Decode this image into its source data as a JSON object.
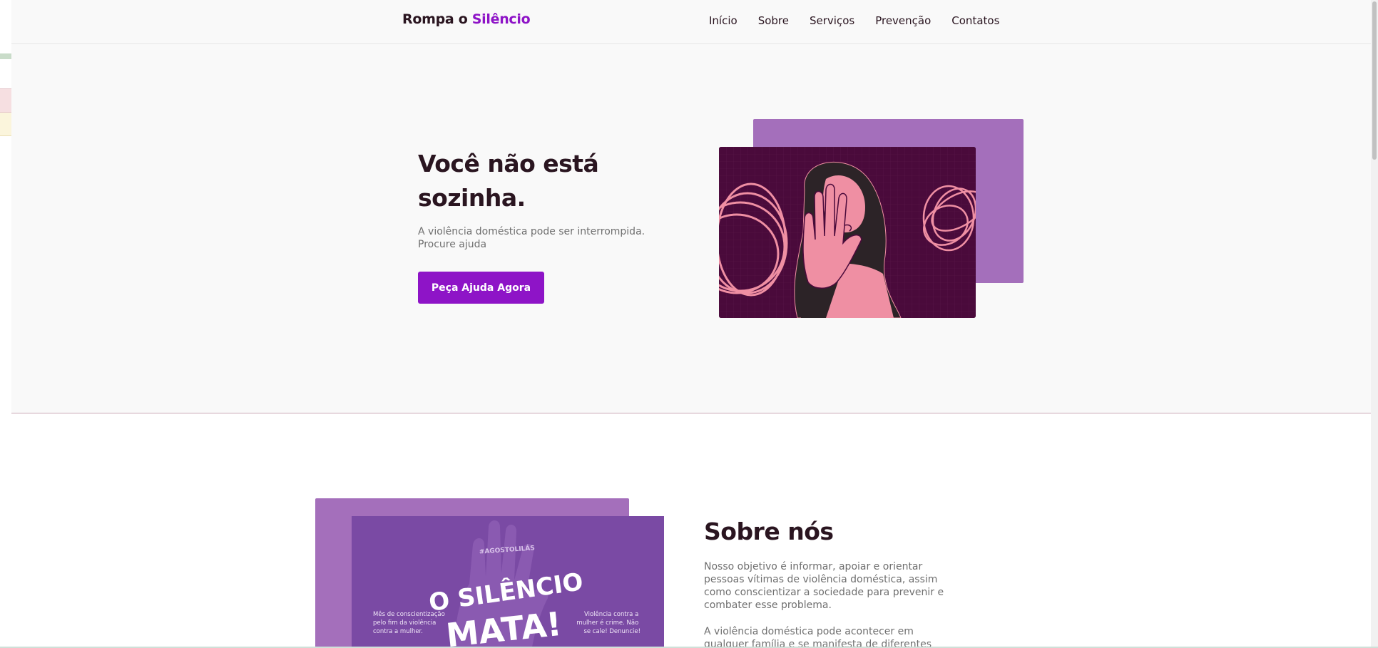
{
  "navbar": {
    "logo_prefix": "Rompa o ",
    "logo_accent": "Silêncio",
    "links": [
      {
        "label": "Início"
      },
      {
        "label": "Sobre"
      },
      {
        "label": "Serviços"
      },
      {
        "label": "Prevenção"
      },
      {
        "label": "Contatos"
      }
    ]
  },
  "hero": {
    "title": "Você não está sozinha.",
    "subtitle": "A violência doméstica pode ser interrompida. Procure ajuda",
    "button_label": "Peça Ajuda Agora",
    "illustration_icon": "woman-stop-hand-illustration"
  },
  "about": {
    "title": "Sobre nós",
    "paragraph1": "Nosso objetivo é informar, apoiar e orientar pessoas vítimas de violência doméstica, assim como conscientizar a sociedade para prevenir e combater esse problema.",
    "paragraph2": "A violência doméstica pode acontecer em qualquer família e se manifesta de diferentes formas: física,",
    "poster": {
      "hashtag": "#AGOSTOLILÁS",
      "headline_line1": "O SILÊNCIO",
      "headline_line2": "MATA!",
      "left_caption": "Mês de conscientização pelo fim da violência contra a mulher.",
      "right_caption": "Violência contra a mulher é crime. Não se cale! Denuncie!"
    }
  },
  "colors": {
    "accent": "#8e14c7",
    "text_dark": "#2a1520",
    "text_muted": "#6f6f6f",
    "frame_purple": "#a46fbb",
    "illustration_bg": "#4a0a3b",
    "illustration_pink": "#ef8fa3"
  }
}
